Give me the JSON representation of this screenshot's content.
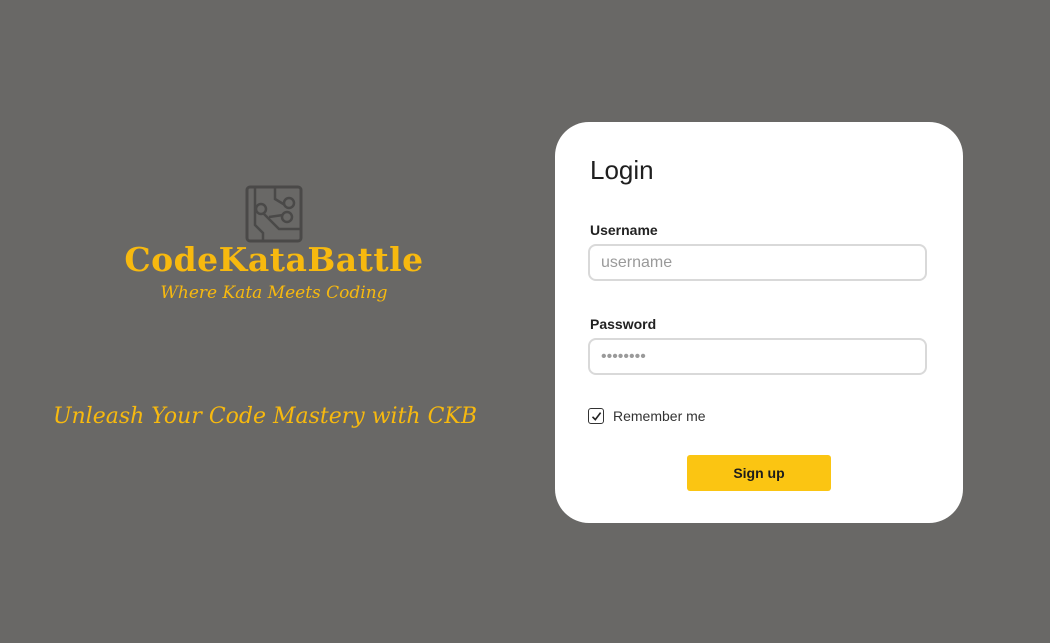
{
  "branding": {
    "logo_icon": "circuit-board-icon",
    "name": "CodeKataBattle",
    "tagline": "Where Kata Meets Coding",
    "slogan": "Unleash Your Code Mastery with CKB",
    "accent_color": "#f7b90f"
  },
  "login": {
    "title": "Login",
    "username_label": "Username",
    "username_placeholder": "username",
    "username_value": "",
    "password_label": "Password",
    "password_placeholder": "••••••••",
    "password_value": "",
    "remember_label": "Remember me",
    "remember_checked": true,
    "submit_label": "Sign up",
    "submit_color": "#fbc512"
  },
  "colors": {
    "background": "#696866",
    "card": "#ffffff"
  }
}
